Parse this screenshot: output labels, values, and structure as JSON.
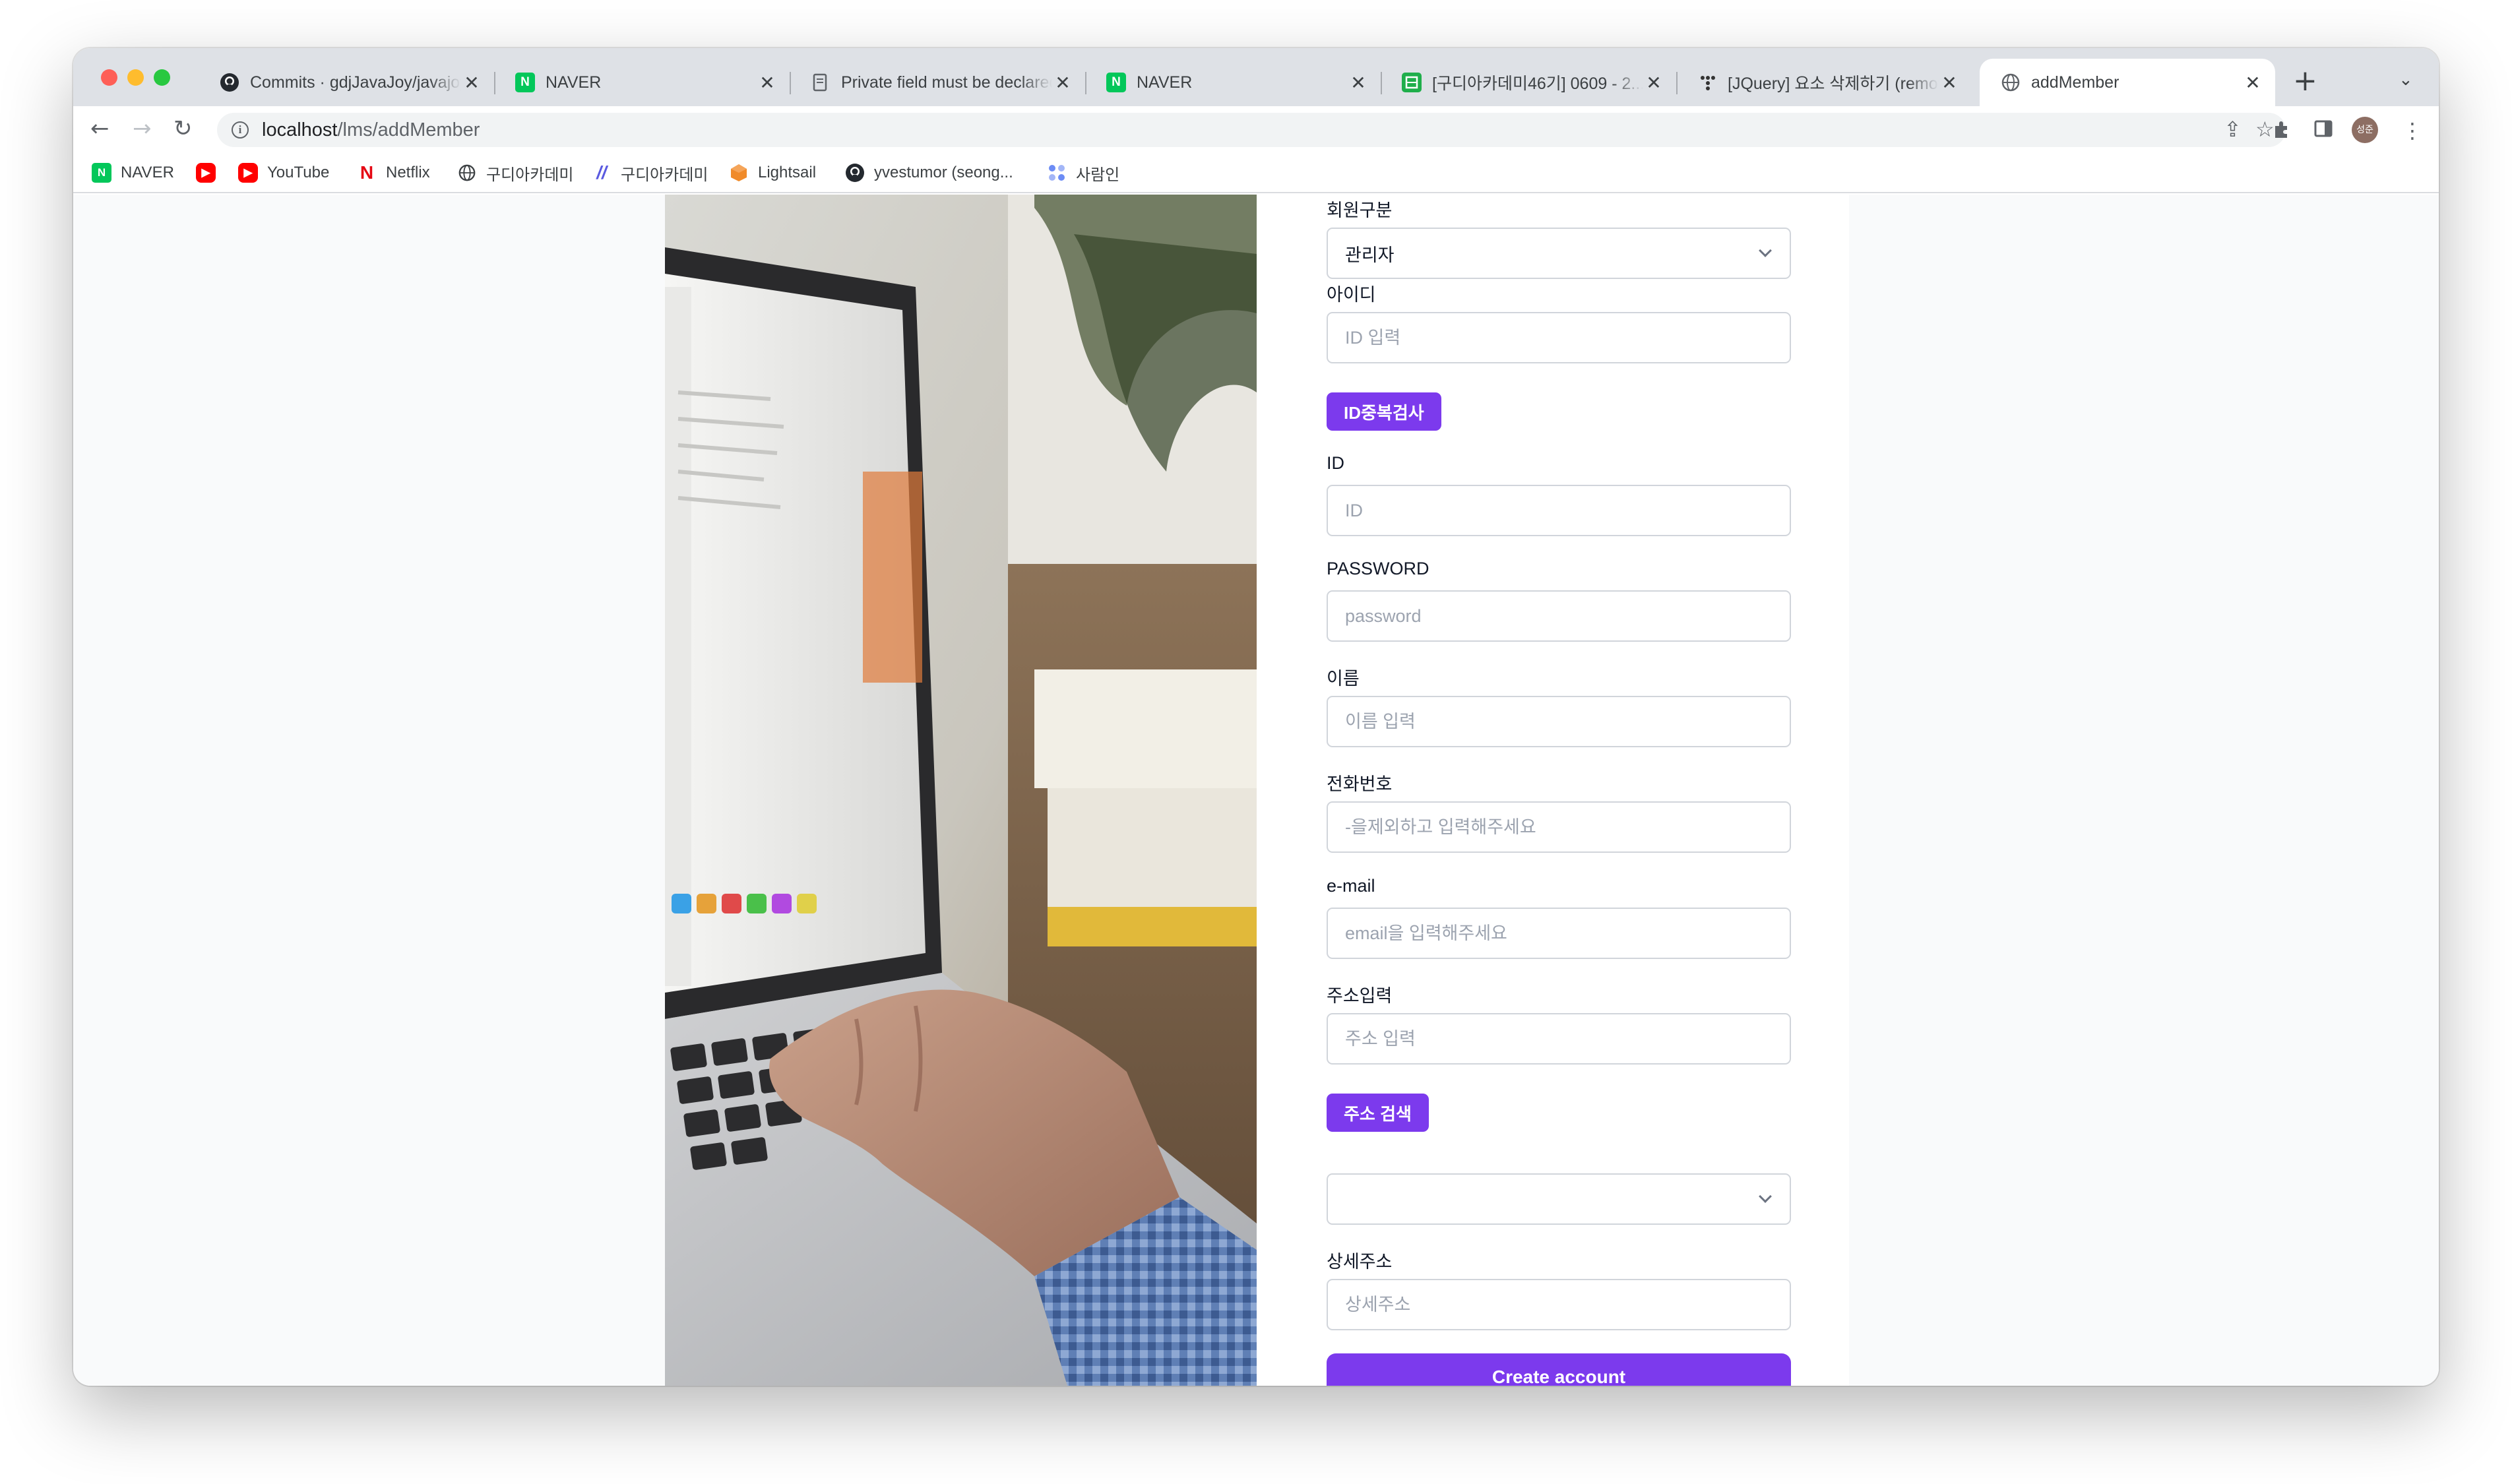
{
  "browser": {
    "tabs": [
      {
        "title": "Commits · gdjJavaJoy/javajoy",
        "favicon_color": "#24292f",
        "favicon_glyph": "github-icon"
      },
      {
        "title": "NAVER",
        "favicon_color": "#03c75a",
        "favicon_glyph": "N"
      },
      {
        "title": "Private field must be declared",
        "favicon_color": "#5f6368",
        "favicon_glyph": "page-icon"
      },
      {
        "title": "NAVER",
        "favicon_color": "#03c75a",
        "favicon_glyph": "N"
      },
      {
        "title": "[구디아카데미46기] 0609 - 2...",
        "favicon_color": "#1fae4b",
        "favicon_glyph": "sheet-icon"
      },
      {
        "title": "[JQuery] 요소 삭제하기 (remove",
        "favicon_color": "#333333",
        "favicon_glyph": "dots-icon"
      },
      {
        "title": "addMember",
        "favicon_color": "#5f6368",
        "favicon_glyph": "globe-icon",
        "active": true
      }
    ],
    "url_host": "localhost",
    "url_path": "/lms/addMember",
    "profile_initials": "성준",
    "bookmarks": [
      {
        "label": "NAVER",
        "icon": "naver-icon"
      },
      {
        "label": "",
        "icon": "youtube-icon"
      },
      {
        "label": "YouTube",
        "icon": "youtube-icon"
      },
      {
        "label": "Netflix",
        "icon": "netflix-icon"
      },
      {
        "label": "구디아카데미",
        "icon": "globe-icon"
      },
      {
        "label": "구디아카데미",
        "icon": "slash-icon"
      },
      {
        "label": "Lightsail",
        "icon": "lightsail-icon"
      },
      {
        "label": "yvestumor (seong...",
        "icon": "github-icon"
      },
      {
        "label": "사람인",
        "icon": "saramin-icon"
      }
    ]
  },
  "form": {
    "member_type_label": "회원구분",
    "member_type_value": "관리자",
    "id_check_label": "아이디",
    "id_check_placeholder": "ID 입력",
    "id_check_button": "ID중복검사",
    "id_label": "ID",
    "id_placeholder": "ID",
    "password_label": "PASSWORD",
    "password_placeholder": "password",
    "name_label": "이름",
    "name_placeholder": "이름 입력",
    "phone_label": "전화번호",
    "phone_placeholder": "-을제외하고 입력해주세요",
    "email_label": "e-mail",
    "email_placeholder": "email을 입력해주세요",
    "address_label": "주소입력",
    "address_placeholder": "주소 입력",
    "address_search_button": "주소 검색",
    "address_select_value": "",
    "detail_address_label": "상세주소",
    "detail_address_placeholder": "상세주소",
    "submit_button": "Create account"
  },
  "colors": {
    "accent": "#7c3aed",
    "page_background": "#f9fafb"
  }
}
